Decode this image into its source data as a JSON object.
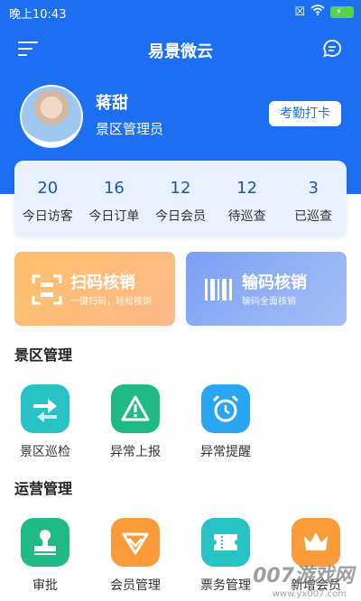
{
  "status_bar": {
    "time": "晚上10:43"
  },
  "header": {
    "title": "易景微云"
  },
  "profile": {
    "name": "蒋甜",
    "role": "景区管理员",
    "checkin_label": "考勤打卡"
  },
  "stats": [
    {
      "value": "20",
      "label": "今日访客"
    },
    {
      "value": "16",
      "label": "今日订单"
    },
    {
      "value": "12",
      "label": "今日会员"
    },
    {
      "value": "12",
      "label": "待巡查"
    },
    {
      "value": "3",
      "label": "已巡查"
    }
  ],
  "verify": {
    "scan": {
      "title": "扫码核销",
      "subtitle": "一键扫码，轻松核销"
    },
    "input": {
      "title": "输码核销",
      "subtitle": "输码全面核销"
    }
  },
  "scenic": {
    "title": "景区管理",
    "items": [
      {
        "label": "景区巡检",
        "icon": "swap-arrows-icon",
        "color": "#27c3c4"
      },
      {
        "label": "异常上报",
        "icon": "warning-icon",
        "color": "#1fba86"
      },
      {
        "label": "异常提醒",
        "icon": "alarm-clock-icon",
        "color": "#2aa5f0"
      }
    ]
  },
  "operations": {
    "title": "运营管理",
    "items": [
      {
        "label": "审批",
        "icon": "stamp-icon",
        "color": "#1fba86"
      },
      {
        "label": "会员管理",
        "icon": "diamond-icon",
        "color": "#fb9b3a"
      },
      {
        "label": "票务管理",
        "icon": "ticket-icon",
        "color": "#27c3c4"
      },
      {
        "label": "新增会员",
        "icon": "crown-icon",
        "color": "#fb9b3a"
      }
    ]
  },
  "watermark": {
    "text": "007游戏网",
    "url": "www.yx007.com"
  }
}
